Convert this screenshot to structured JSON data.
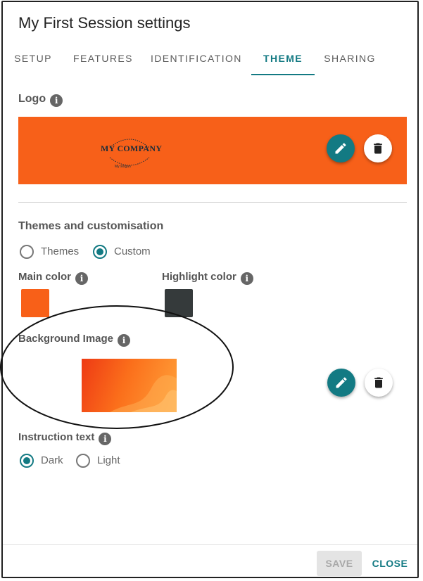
{
  "dialog": {
    "title": "My First Session settings"
  },
  "tabs": [
    {
      "label": "SETUP",
      "active": false
    },
    {
      "label": "FEATURES",
      "active": false
    },
    {
      "label": "IDENTIFICATION",
      "active": false
    },
    {
      "label": "THEME",
      "active": true
    },
    {
      "label": "SHARING",
      "active": false
    }
  ],
  "logo_section": {
    "label": "Logo",
    "logo_text": "MY COMPANY",
    "logo_slogan": "My slogan",
    "banner_color": "#f76019"
  },
  "themes_section": {
    "label": "Themes and customisation",
    "options": [
      {
        "label": "Themes",
        "selected": false
      },
      {
        "label": "Custom",
        "selected": true
      }
    ]
  },
  "colors": {
    "main": {
      "label": "Main color",
      "value": "#f86018"
    },
    "highlight": {
      "label": "Highlight color",
      "value": "#353a3b"
    },
    "accent": "#137a83"
  },
  "background_image": {
    "label": "Background Image"
  },
  "instruction_text": {
    "label": "Instruction text",
    "options": [
      {
        "label": "Dark",
        "selected": true
      },
      {
        "label": "Light",
        "selected": false
      }
    ]
  },
  "footer": {
    "save_label": "SAVE",
    "save_disabled": true,
    "close_label": "CLOSE"
  },
  "icons": {
    "edit": "pencil-icon",
    "delete": "trash-icon",
    "info": "info-icon"
  }
}
